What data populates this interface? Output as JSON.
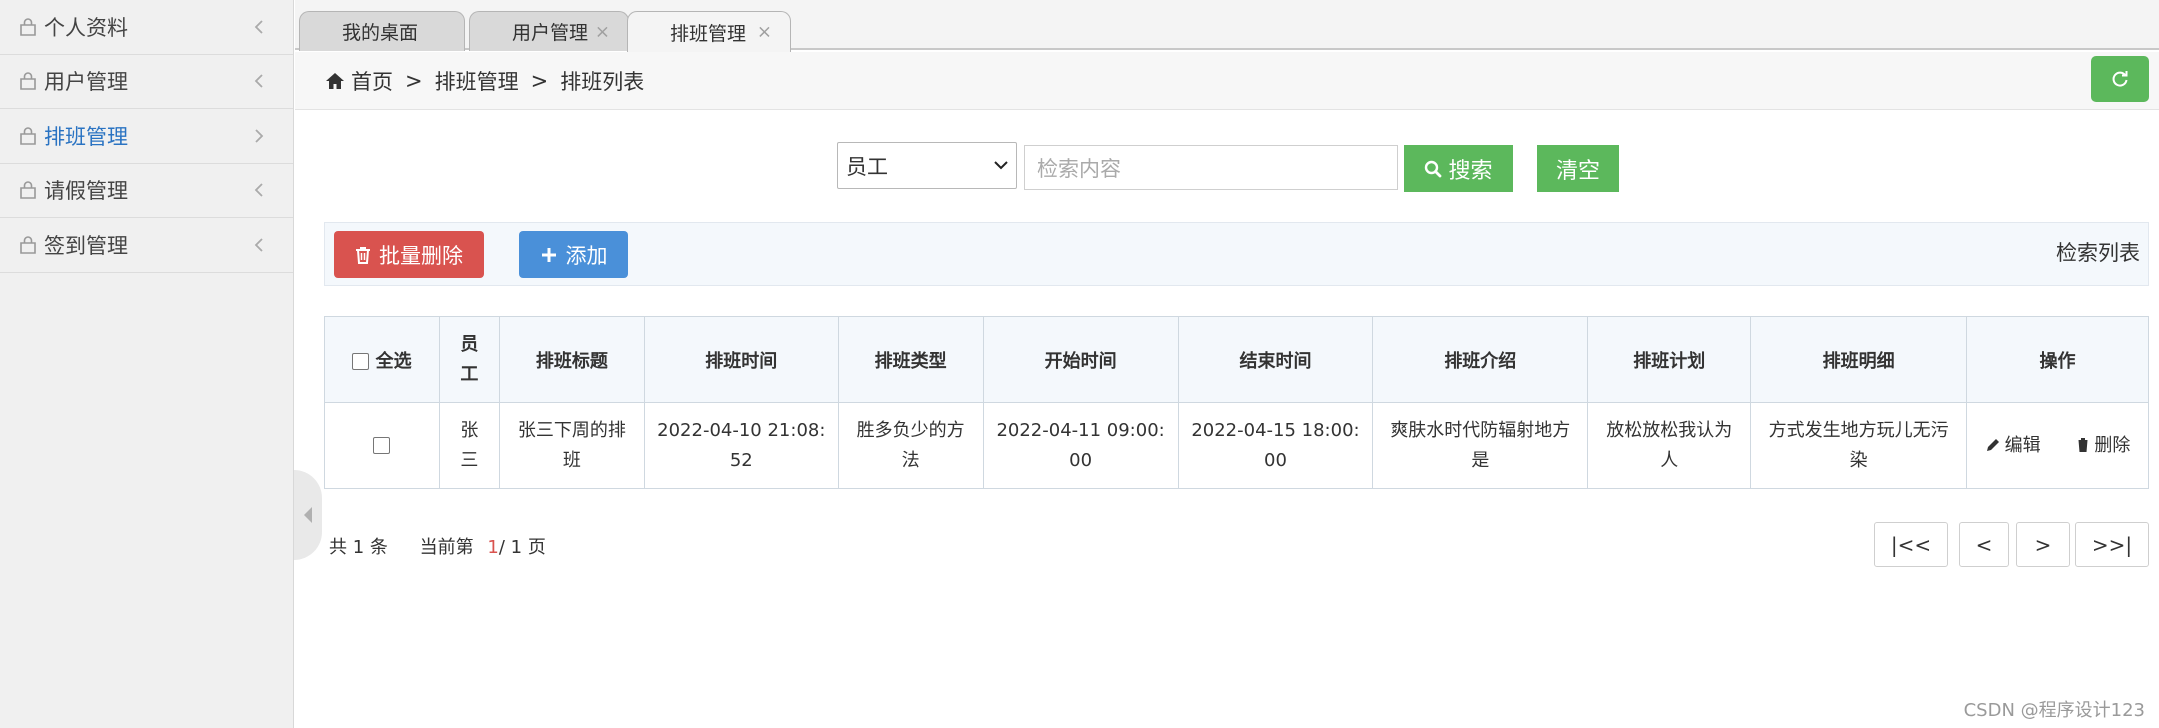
{
  "sidebar": {
    "items": [
      {
        "label": "个人资料",
        "active": false
      },
      {
        "label": "用户管理",
        "active": false
      },
      {
        "label": "排班管理",
        "active": true
      },
      {
        "label": "请假管理",
        "active": false
      },
      {
        "label": "签到管理",
        "active": false
      }
    ]
  },
  "tabs": [
    {
      "label": "我的桌面"
    },
    {
      "label": "用户管理",
      "close": "×"
    },
    {
      "label": "排班管理",
      "close": "×"
    }
  ],
  "breadcrumb": {
    "home": "首页",
    "sep": ">",
    "level1": "排班管理",
    "level2": "排班列表"
  },
  "search": {
    "field_selected": "员工",
    "placeholder": "检索内容",
    "search_label": "搜索",
    "clear_label": "清空"
  },
  "toolbar": {
    "batch_delete_label": "批量删除",
    "add_label": "添加",
    "title": "检索列表"
  },
  "table": {
    "headers": {
      "select_all": "全选",
      "employee": "员工",
      "title": "排班标题",
      "time": "排班时间",
      "type": "排班类型",
      "start": "开始时间",
      "end": "结束时间",
      "intro": "排班介绍",
      "plan": "排班计划",
      "detail": "排班明细",
      "ops": "操作"
    },
    "rows": [
      {
        "employee": "张三",
        "title": "张三下周的排班",
        "time": "2022-04-10 21:08:52",
        "type": "胜多负少的方法",
        "start": "2022-04-11 09:00:00",
        "end": "2022-04-15 18:00:00",
        "intro": "爽肤水时代防辐射地方是",
        "plan": "放松放松我认为人",
        "detail": "方式发生地方玩儿无污染",
        "edit_label": "编辑",
        "delete_label": "删除"
      }
    ]
  },
  "pagination": {
    "total_prefix": "共",
    "total": "1",
    "total_suffix": "条",
    "current_prefix": "当前第",
    "current_page": "1",
    "slash": "/",
    "total_pages": "1",
    "page_suffix": "页",
    "first": "|<<",
    "prev": "<",
    "next": ">",
    "last": ">>|"
  },
  "watermark": "CSDN @程序设计123",
  "colors": {
    "green": "#5cb85c",
    "red": "#d9534f",
    "blue": "#4a90d9",
    "active_link": "#2a73c2"
  }
}
